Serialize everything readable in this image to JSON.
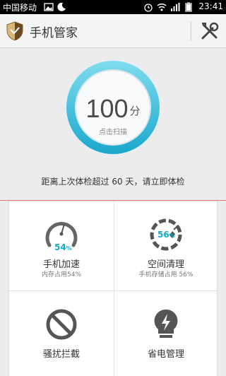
{
  "status_bar": {
    "carrier": "中国移动",
    "time": "23:41"
  },
  "app_bar": {
    "title": "手机管家"
  },
  "score": {
    "value": "100",
    "unit": "分",
    "hint": "点击扫描"
  },
  "notice": "距离上次体检超过 60 天，请立即体检",
  "tiles": [
    {
      "label": "手机加速",
      "sub": "内存占用54%",
      "value": 54,
      "value_text": "54",
      "unit": "%"
    },
    {
      "label": "空间清理",
      "sub": "手机存储占用 56%",
      "value": 56,
      "value_text": "56",
      "unit": "%"
    },
    {
      "label": "骚扰拦截"
    },
    {
      "label": "省电管理"
    }
  ],
  "colors": {
    "accent": "#17a8c8",
    "dial_ring": "#1fb7d8",
    "alert_line": "#e0806f"
  }
}
